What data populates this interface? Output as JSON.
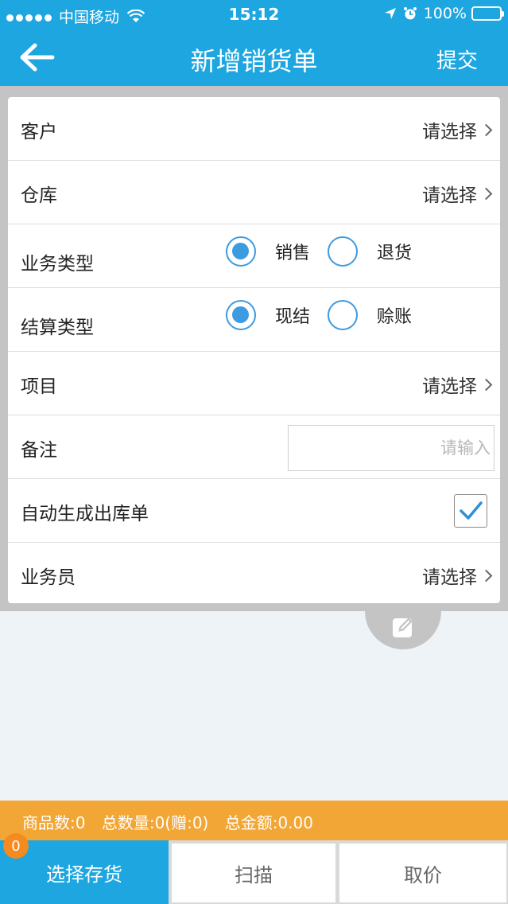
{
  "status_bar": {
    "carrier": "中国移动",
    "time": "15:12",
    "battery": "100%"
  },
  "nav": {
    "title": "新增销货单",
    "submit_label": "提交"
  },
  "form": {
    "customer": {
      "label": "客户",
      "value": "请选择"
    },
    "warehouse": {
      "label": "仓库",
      "value": "请选择"
    },
    "business_type": {
      "label": "业务类型",
      "options": [
        "销售",
        "退货"
      ],
      "selected": "销售"
    },
    "settlement_type": {
      "label": "结算类型",
      "options": [
        "现结",
        "赊账"
      ],
      "selected": "现结"
    },
    "project": {
      "label": "项目",
      "value": "请选择"
    },
    "remark": {
      "label": "备注",
      "value": "",
      "placeholder": "请输入"
    },
    "auto_outbound": {
      "label": "自动生成出库单",
      "checked": true
    },
    "salesperson": {
      "label": "业务员",
      "value": "请选择"
    }
  },
  "summary": {
    "item_count": "商品数:0",
    "total_qty": "总数量:0(赠:0)",
    "total_amount": "总金额:0.00"
  },
  "bottom": {
    "badge_count": "0",
    "select_stock": "选择存货",
    "scan": "扫描",
    "get_price": "取价"
  },
  "colors": {
    "primary": "#1da6e0",
    "accent": "#f2a636",
    "radio": "#3d9be0",
    "badge": "#f58a1f"
  }
}
